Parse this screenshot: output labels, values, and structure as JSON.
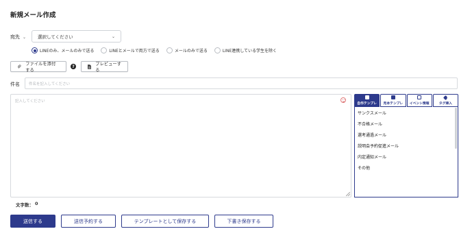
{
  "page": {
    "title": "新規メール作成"
  },
  "destination": {
    "label": "宛先",
    "select_value": "選択してください"
  },
  "send_mode": {
    "options": [
      {
        "label": "LINEのみ、メールのみで送る",
        "checked": true
      },
      {
        "label": "LINEとメールで両方で送る",
        "checked": false
      },
      {
        "label": "メールのみで送る",
        "checked": false
      },
      {
        "label": "LINE連携している学生を除く",
        "checked": false
      }
    ]
  },
  "toolbar": {
    "attach_label": "ファイルを添付する",
    "help_glyph": "?",
    "preview_label": "プレビューする"
  },
  "subject": {
    "label": "件名",
    "placeholder": "件名を記入してください"
  },
  "body": {
    "placeholder": "記入してください"
  },
  "templates": {
    "tabs": [
      {
        "label": "自作テンプレ",
        "icon": "document-icon",
        "active": true
      },
      {
        "label": "見本テンプレ",
        "icon": "document-icon",
        "active": false
      },
      {
        "label": "イベント情報",
        "icon": "calendar-icon",
        "active": false
      },
      {
        "label": "タグ挿入",
        "icon": "tag-icon",
        "active": false
      }
    ],
    "items": [
      "サンクスメール",
      "不合格メール",
      "選考通過メール",
      "説明会予約促進メール",
      "内定通知メール",
      "その他"
    ]
  },
  "char_count": {
    "label": "文字数：",
    "value": "0"
  },
  "footer": {
    "send_label": "送信する",
    "schedule_label": "送信予約する",
    "save_template_label": "テンプレートとして保存する",
    "draft_label": "下書き保存する"
  },
  "colors": {
    "primary": "#2d3a8c",
    "border": "#cfd3d8"
  }
}
